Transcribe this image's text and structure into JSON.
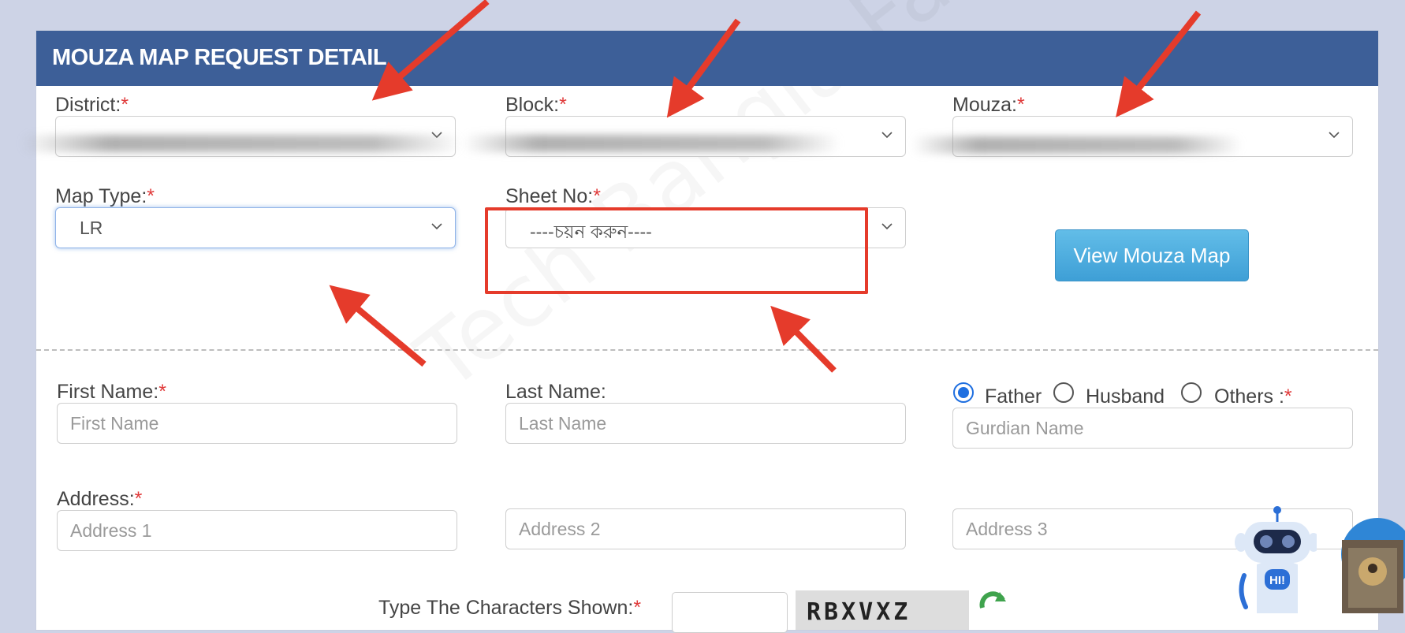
{
  "header": {
    "title": "MOUZA MAP REQUEST DETAIL"
  },
  "watermark": "Tech Bangla Family",
  "location": {
    "district": {
      "label": "District:",
      "required": "*"
    },
    "block": {
      "label": "Block:",
      "required": "*"
    },
    "mouza": {
      "label": "Mouza:",
      "required": "*"
    }
  },
  "map": {
    "map_type": {
      "label": "Map Type:",
      "required": "*",
      "value": "LR"
    },
    "sheet_no": {
      "label": "Sheet No:",
      "required": "*",
      "value": "----চয়ন করুন----"
    },
    "view_button": "View Mouza Map"
  },
  "applicant": {
    "first_name": {
      "label": "First Name:",
      "required": "*",
      "placeholder": "First Name"
    },
    "last_name": {
      "label": "Last Name:",
      "placeholder": "Last Name"
    },
    "relation": {
      "options": [
        "Father",
        "Husband",
        "Others :"
      ],
      "selected": "Father",
      "required": "*",
      "placeholder": "Gurdian Name"
    },
    "address": {
      "label": "Address:",
      "required": "*",
      "placeholders": [
        "Address 1",
        "Address 2",
        "Address 3"
      ]
    }
  },
  "captcha": {
    "label": "Type The Characters Shown:",
    "required": "*",
    "code": "RBXVXZ"
  },
  "chatbot": {
    "greeting": "HI!"
  },
  "colors": {
    "header": "#3d5f98",
    "required": "#e03a3a",
    "button": "#4aaade",
    "highlight": "#e53b2b",
    "radio": "#1f6fe0"
  }
}
